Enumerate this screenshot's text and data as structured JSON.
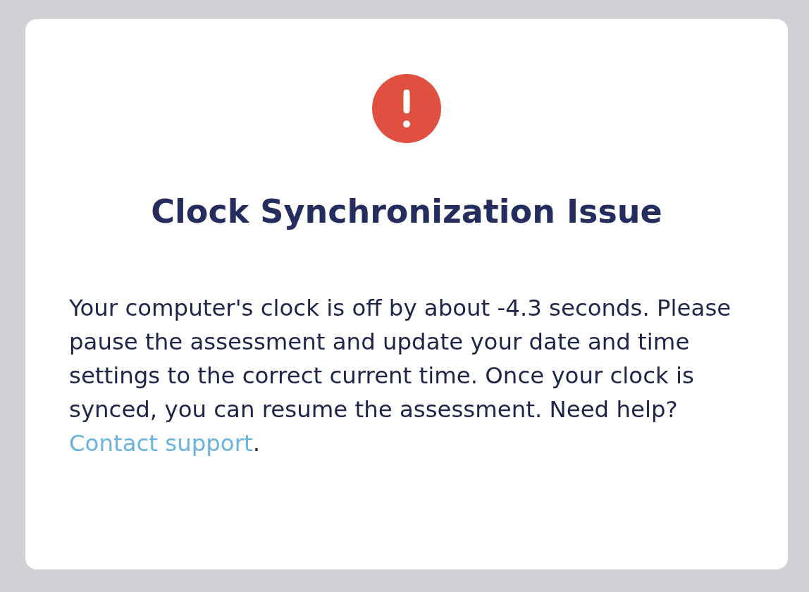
{
  "dialog": {
    "title": "Clock Synchronization Issue",
    "message": "Your computer's clock is off by about -4.3 seconds. Please pause the assessment and update your date and time settings to the correct current time. Once your clock is synced, you can resume the assessment. Need help?",
    "link": "Contact support",
    "after_link": "."
  }
}
